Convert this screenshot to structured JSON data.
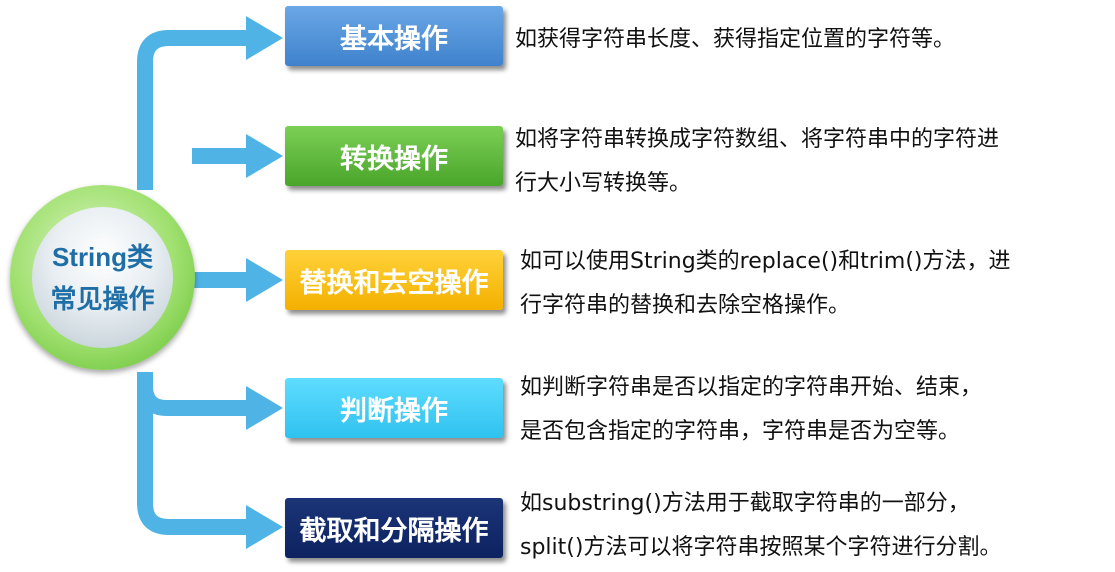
{
  "hub": {
    "lines": [
      "String类",
      "常见操作"
    ]
  },
  "nodes": [
    {
      "label": "基本操作",
      "desc": [
        "如获得字符串长度、获得指定位置的字符等。"
      ]
    },
    {
      "label": "转换操作",
      "desc": [
        "如将字符串转换成字符数组、将字符串中的字符进",
        "行大小写转换等。"
      ]
    },
    {
      "label": "替换和去空操作",
      "desc": [
        "如可以使用String类的replace()和trim()方法，进",
        "行字符串的替换和去除空格操作。"
      ]
    },
    {
      "label": "判断操作",
      "desc": [
        "如判断字符串是否以指定的字符串开始、结束，",
        "是否包含指定的字符串，字符串是否为空等。"
      ]
    },
    {
      "label": "截取和分隔操作",
      "desc": [
        "如substring()方法用于截取字符串的一部分，",
        "split()方法可以将字符串按照某个字符进行分割。"
      ]
    }
  ],
  "colors": {
    "arrow": "#4fb3e6",
    "node1": "#4a8fd8",
    "node2": "#5cb83a",
    "node3": "#f7bf12",
    "node4": "#3fcdf5",
    "node5": "#142c6c",
    "hub_ring": "#7fd04c",
    "hub_text": "#1f6fa6"
  },
  "icons": [
    "right-arrow-icon"
  ]
}
